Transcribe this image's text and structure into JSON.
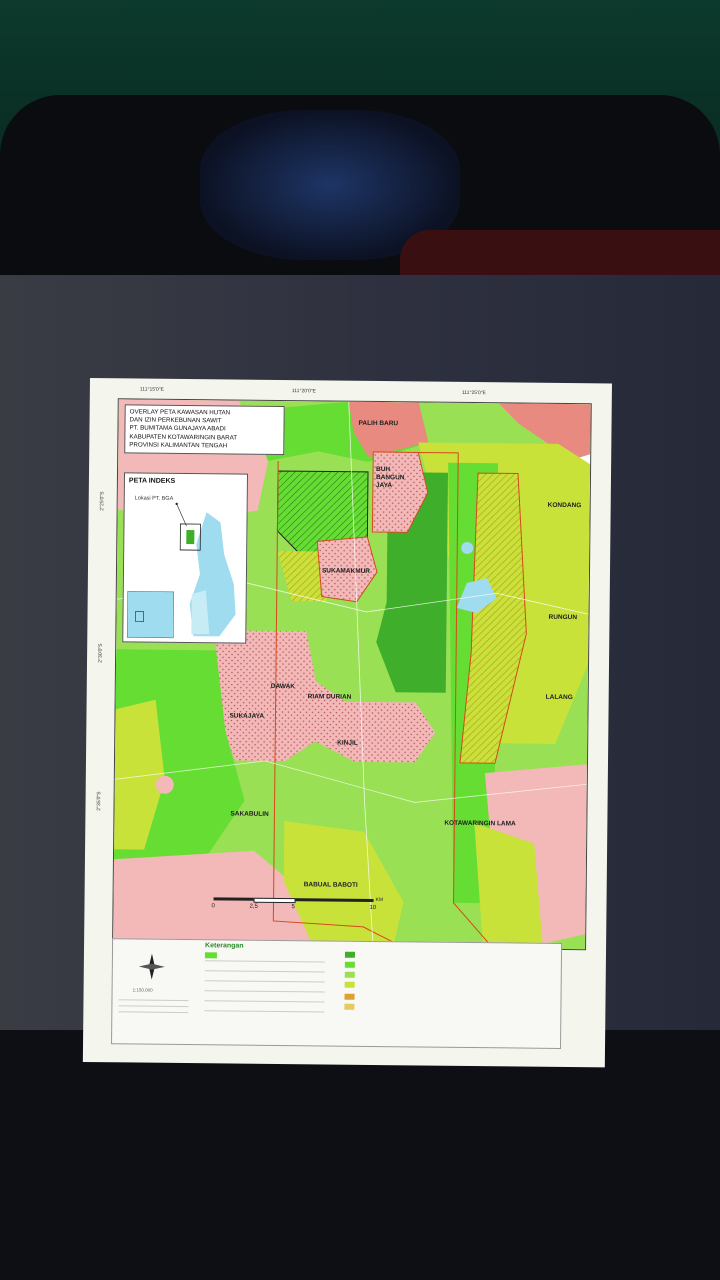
{
  "map": {
    "title_lines": [
      "OVERLAY PETA KAWASAN HUTAN",
      "DAN IZIN PERKEBUNAN SAWIT",
      "PT. BUMITAMA GUNAJAYA ABADI",
      "KABUPATEN KOTAWARINGIN BARAT",
      "PROVINSI KALIMANTAN TENGAH"
    ],
    "index_title": "PETA INDEKS",
    "index_location": "Lokasi PT. BGA",
    "places": {
      "palih_baru": "PALIH BARU",
      "bangun_jaya": "BUH BANGUN JAYA",
      "sukamakmur": "SUKAMAKMUR",
      "kondang": "KONDANG",
      "rungun": "RUNGUN",
      "dawak": "DAWAK",
      "riam_durian": "RIAM DURIAN",
      "lalang": "LALANG",
      "sukajaya": "SUKAJAYA",
      "kinjil": "KINJIL",
      "sakabulin": "SAKABULIN",
      "kotawaringin_lama": "KOTAWARINGIN LAMA",
      "babual_baboti": "BABUAL BABOTI"
    },
    "coords": {
      "top_1": "111°15'0\"E",
      "top_2": "111°20'0\"E",
      "top_3": "111°25'0\"E",
      "left_1": "2°25'0\"S",
      "left_2": "2°30'0\"S",
      "left_3": "2°35'0\"S"
    },
    "scale": {
      "ticks": [
        "0",
        "2,5",
        "5",
        "10"
      ],
      "unit": "KM"
    },
    "legend_title": "Keterangan",
    "scale_ratio": "1:150.000",
    "colors": {
      "bright_green": "#66dd33",
      "light_green": "#99e055",
      "dark_green": "#3fae2a",
      "yellow_green": "#c9e23a",
      "pink": "#f3b8b8",
      "salmon": "#e98a80",
      "water": "#9fdcf0",
      "boundary": "#d44a1a"
    }
  }
}
